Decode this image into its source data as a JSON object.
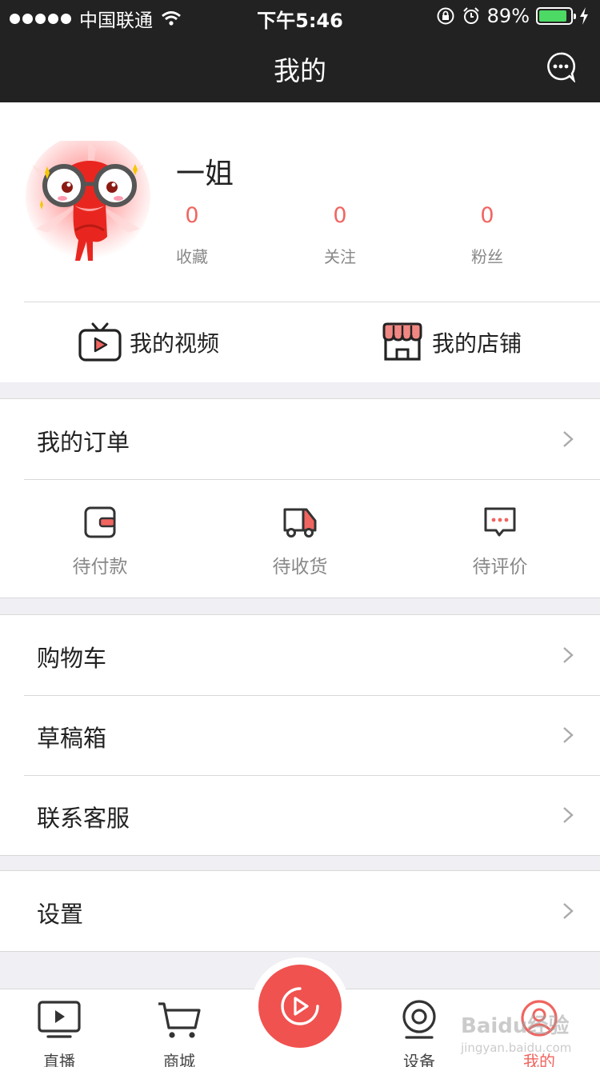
{
  "status_bar": {
    "carrier": "中国联通",
    "time": "下午5:46",
    "battery": "89%",
    "battery_level": 0.89
  },
  "nav": {
    "title": "我的"
  },
  "profile": {
    "username": "一姐",
    "stats": [
      {
        "value": "0",
        "label": "收藏"
      },
      {
        "value": "0",
        "label": "关注"
      },
      {
        "value": "0",
        "label": "粉丝"
      }
    ],
    "quick_links": [
      {
        "label": "我的视频"
      },
      {
        "label": "我的店铺"
      }
    ]
  },
  "orders": {
    "title": "我的订单",
    "items": [
      {
        "label": "待付款"
      },
      {
        "label": "待收货"
      },
      {
        "label": "待评价"
      }
    ]
  },
  "menu": [
    {
      "label": "购物车"
    },
    {
      "label": "草稿箱"
    },
    {
      "label": "联系客服"
    }
  ],
  "settings": {
    "label": "设置"
  },
  "tabbar": {
    "tabs": [
      {
        "label": "直播"
      },
      {
        "label": "商城"
      },
      {
        "label": "设备"
      },
      {
        "label": "我的"
      }
    ],
    "active": "我的"
  },
  "colors": {
    "accent": "#f06560",
    "nav_bg": "#222222",
    "fab": "#f0524f",
    "battery": "#4cd964"
  },
  "watermark": {
    "brand": "Baidu经验",
    "url": "jingyan.baidu.com"
  }
}
